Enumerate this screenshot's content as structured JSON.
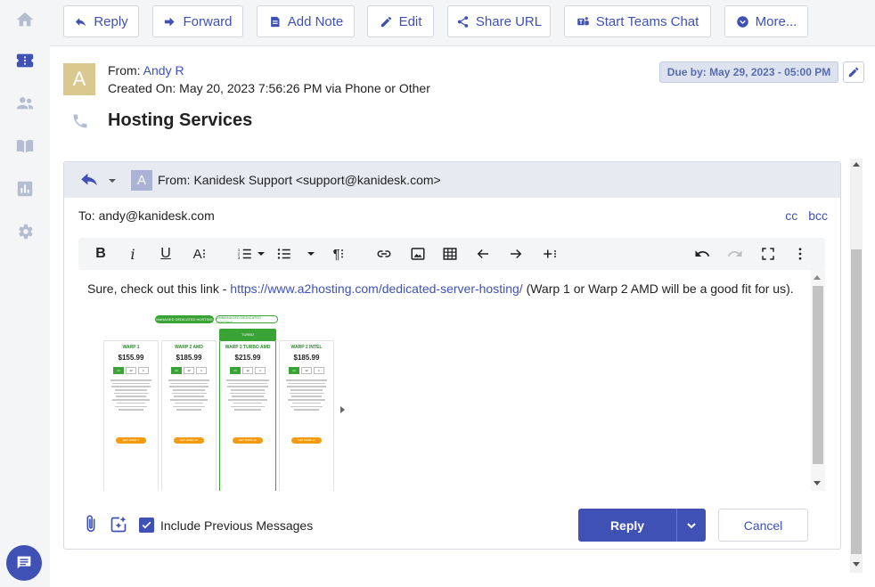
{
  "toolbar": {
    "reply": "Reply",
    "forward": "Forward",
    "add_note": "Add Note",
    "edit": "Edit",
    "share_url": "Share URL",
    "teams_chat": "Start Teams Chat",
    "more": "More..."
  },
  "ticket": {
    "avatar_letter": "A",
    "from_label": "From: ",
    "from_name": "Andy R",
    "created": "Created On: May 20, 2023 7:56:26 PM via Phone or Other",
    "due": "Due by: May 29, 2023 - 05:00 PM",
    "subject": "Hosting Services"
  },
  "reply": {
    "avatar_letter": "A",
    "from": "From:  Kanidesk Support <support@kanidesk.com>",
    "to": "To: andy@kanidesk.com",
    "cc": "cc",
    "bcc": "bcc",
    "body_prefix": "Sure, check out this link - ",
    "body_link": "https://www.a2hosting.com/dedicated-server-hosting/",
    "body_suffix": " (Warp 1 or Warp 2 AMD will be a good fit for us).",
    "include_previous": "Include Previous Messages",
    "include_checked": true,
    "reply_button": "Reply",
    "cancel_button": "Cancel"
  },
  "pricing_image": {
    "tab_managed": "MANAGED DEDICATED HOSTING",
    "tab_unmanaged": "UNMANAGED DEDICATED HOSTING",
    "turbo_label": "TURBO",
    "plans": [
      {
        "name": "WARP 1",
        "price": "$155.99",
        "cta": "GET WARP 1"
      },
      {
        "name": "WARP 2 AMD",
        "price": "$185.99",
        "cta": "GET WARP 2A"
      },
      {
        "name": "WARP 2 TURBO AMD",
        "price": "$215.99",
        "cta": "GET WARP 2A"
      },
      {
        "name": "WARP 2 INTEL",
        "price": "$185.99",
        "cta": "GET WARP 2I"
      }
    ]
  },
  "colors": {
    "accent": "#3f51b5",
    "due_bg": "#dde2ef",
    "avatar": "#d9c98e"
  }
}
